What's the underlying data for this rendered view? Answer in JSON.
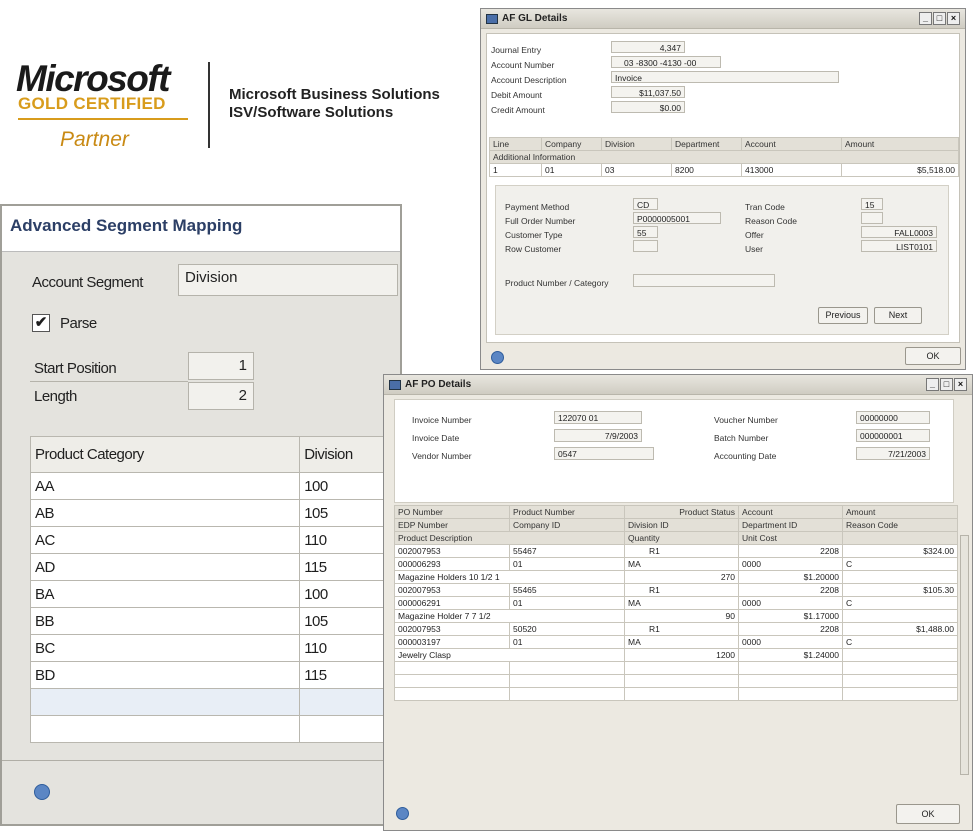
{
  "logo": {
    "microsoft": "Microsoft",
    "gold": "GOLD CERTIFIED",
    "partner": "Partner",
    "line1": "Microsoft Business Solutions",
    "line2": "ISV/Software Solutions"
  },
  "gl": {
    "title": "AF GL Details",
    "fields": {
      "journal_entry_label": "Journal Entry",
      "journal_entry": "4,347",
      "account_number_label": "Account Number",
      "account_number": "03 -8300 -4130 -00",
      "account_description_label": "Account Description",
      "account_description": "Invoice",
      "debit_amount_label": "Debit Amount",
      "debit_amount": "$11,037.50",
      "credit_amount_label": "Credit Amount",
      "credit_amount": "$0.00"
    },
    "grid_headers": [
      "Line",
      "Company",
      "Division",
      "Department",
      "Account",
      "Amount"
    ],
    "additional_info": "Additional Information",
    "row": [
      "1",
      "01",
      "03",
      "8200",
      "413000",
      "$5,518.00"
    ],
    "details": {
      "payment_method_label": "Payment Method",
      "payment_method": "CD",
      "full_order_label": "Full Order Number",
      "full_order": "P0000005001",
      "customer_type_label": "Customer Type",
      "customer_type": "55",
      "row_customer_label": "Row Customer",
      "tran_code_label": "Tran Code",
      "tran_code": "15",
      "reason_code_label": "Reason Code",
      "offer_label": "Offer",
      "offer": "FALL0003",
      "user_label": "User",
      "user": "LIST0101",
      "product_label": "Product Number / Category"
    },
    "previous": "Previous",
    "next": "Next",
    "ok": "OK"
  },
  "po": {
    "title": "AF PO Details",
    "invoice_number_label": "Invoice Number",
    "invoice_number": "122070  01",
    "invoice_date_label": "Invoice Date",
    "invoice_date": "7/9/2003",
    "vendor_number_label": "Vendor Number",
    "vendor_number": "0547",
    "voucher_number_label": "Voucher Number",
    "voucher_number": "00000000",
    "batch_number_label": "Batch Number",
    "batch_number": "000000001",
    "accounting_date_label": "Accounting Date",
    "accounting_date": "7/21/2003",
    "headers1": [
      "PO Number",
      "Product Number",
      "Product Status",
      "Account",
      "Amount"
    ],
    "headers2": [
      "EDP Number",
      "Company ID",
      "Division ID",
      "Department ID",
      "Reason Code"
    ],
    "headers3": [
      "Product Description",
      "Quantity",
      "Unit Cost"
    ],
    "rows": [
      {
        "po": "002007953",
        "product": "55467",
        "status": "R1",
        "account": "2208",
        "amount": "$324.00",
        "edp": "000006293",
        "company": "01",
        "division": "MA",
        "dept": "0000",
        "reason": "C",
        "desc": "Magazine Holders 10 1/2 1",
        "qty": "270",
        "cost": "$1.20000"
      },
      {
        "po": "002007953",
        "product": "55465",
        "status": "R1",
        "account": "2208",
        "amount": "$105.30",
        "edp": "000006291",
        "company": "01",
        "division": "MA",
        "dept": "0000",
        "reason": "C",
        "desc": "Magazine Holder 7 7 1/2",
        "qty": "90",
        "cost": "$1.17000"
      },
      {
        "po": "002007953",
        "product": "50520",
        "status": "R1",
        "account": "2208",
        "amount": "$1,488.00",
        "edp": "000003197",
        "company": "01",
        "division": "MA",
        "dept": "0000",
        "reason": "C",
        "desc": "Jewelry Clasp",
        "qty": "1200",
        "cost": "$1.24000"
      }
    ],
    "ok": "OK"
  },
  "asm": {
    "title": "Advanced Segment Mapping",
    "account_segment_label": "Account Segment",
    "account_segment": "Division",
    "parse_label": "Parse",
    "parse_checked": true,
    "start_position_label": "Start Position",
    "start_position": "1",
    "length_label": "Length",
    "length": "2",
    "col_product": "Product Category",
    "col_division": "Division",
    "rows": [
      {
        "cat": "AA",
        "div": "100"
      },
      {
        "cat": "AB",
        "div": "105"
      },
      {
        "cat": "AC",
        "div": "110"
      },
      {
        "cat": "AD",
        "div": "115"
      },
      {
        "cat": "BA",
        "div": "100"
      },
      {
        "cat": "BB",
        "div": "105"
      },
      {
        "cat": "BC",
        "div": "110"
      },
      {
        "cat": "BD",
        "div": "115"
      }
    ]
  }
}
